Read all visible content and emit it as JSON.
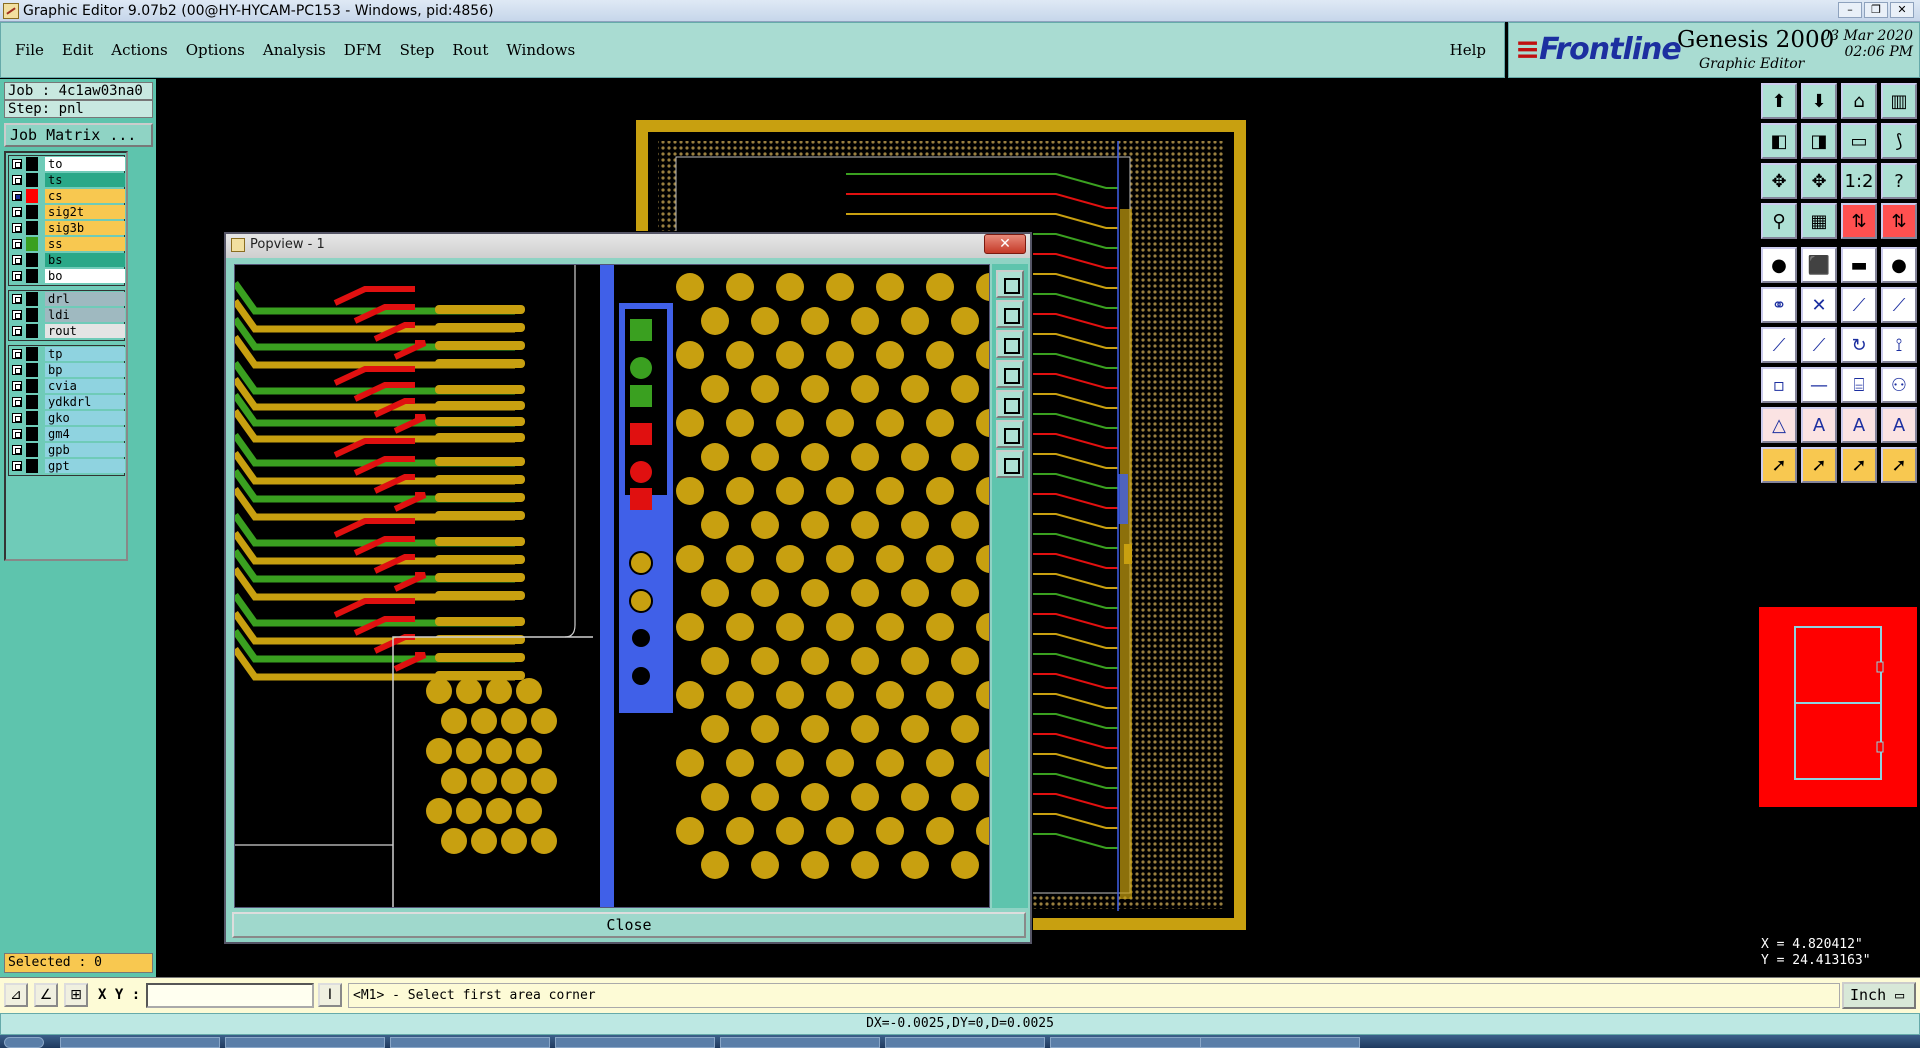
{
  "titlebar": {
    "title": "Graphic Editor 9.07b2 (00@HY-HYCAM-PC153 - Windows, pid:4856)"
  },
  "menu": {
    "items": [
      "File",
      "Edit",
      "Actions",
      "Options",
      "Analysis",
      "DFM",
      "Step",
      "Rout",
      "Windows"
    ],
    "help": "Help"
  },
  "brand": {
    "logo": "Frontline",
    "product": "Genesis 2000",
    "subtitle": "Graphic Editor",
    "date": "03 Mar 2020",
    "time": "02:06 PM"
  },
  "job": {
    "job_line": "Job : 4c1aw03na0",
    "step_line": "Step: pnl",
    "matrix_button": "Job Matrix ..."
  },
  "layers": {
    "group1": [
      {
        "name": "to",
        "swatch": "#000000",
        "bg": "#ffffff",
        "checked": false
      },
      {
        "name": "ts",
        "swatch": "#000000",
        "bg": "#2aa888",
        "checked": false
      },
      {
        "name": "cs",
        "swatch": "#ff0000",
        "bg": "#f8c850",
        "checked": true
      },
      {
        "name": "sig2t",
        "swatch": "#000000",
        "bg": "#f8c850",
        "checked": false
      },
      {
        "name": "sig3b",
        "swatch": "#000000",
        "bg": "#f8c850",
        "checked": false
      },
      {
        "name": "ss",
        "swatch": "#3aa020",
        "bg": "#f8c850",
        "checked": false
      },
      {
        "name": "bs",
        "swatch": "#000000",
        "bg": "#2aa888",
        "checked": false
      },
      {
        "name": "bo",
        "swatch": "#000000",
        "bg": "#ffffff",
        "checked": false
      }
    ],
    "group2": [
      {
        "name": "drl",
        "swatch": "#000000",
        "bg": "#9fb9c0",
        "checked": false
      },
      {
        "name": "ldi",
        "swatch": "#000000",
        "bg": "#9fb9c0",
        "checked": false
      },
      {
        "name": "rout",
        "swatch": "#000000",
        "bg": "#e4e4e4",
        "checked": false
      }
    ],
    "group3": [
      {
        "name": "tp",
        "swatch": "#000000",
        "bg": "#8fd3e0",
        "checked": false
      },
      {
        "name": "bp",
        "swatch": "#000000",
        "bg": "#8fd3e0",
        "checked": false
      },
      {
        "name": "cvia",
        "swatch": "#000000",
        "bg": "#8fd3e0",
        "checked": false
      },
      {
        "name": "ydkdrl",
        "swatch": "#000000",
        "bg": "#8fd3e0",
        "checked": false
      },
      {
        "name": "gko",
        "swatch": "#000000",
        "bg": "#8fd3e0",
        "checked": false
      },
      {
        "name": "gm4",
        "swatch": "#000000",
        "bg": "#8fd3e0",
        "checked": false
      },
      {
        "name": "gpb",
        "swatch": "#000000",
        "bg": "#8fd3e0",
        "checked": false
      },
      {
        "name": "gpt",
        "swatch": "#000000",
        "bg": "#8fd3e0",
        "checked": false
      }
    ]
  },
  "selected": "Selected : 0",
  "popview": {
    "title": "Popview - 1",
    "close_label": "Close"
  },
  "coords": {
    "x": "X = 4.820412\"",
    "y": "Y = 24.413163\""
  },
  "bottom": {
    "xy_label": "X Y :",
    "xy_value": "",
    "prompt": "<M1> - Select first area corner",
    "unit": "Inch",
    "status": "DX=-0.0025,DY=0,D=0.0025"
  },
  "colors": {
    "copper": "#c8a010",
    "trace_red": "#e01010",
    "trace_green": "#3aa020",
    "pad_blue": "#4060e8",
    "background": "#000000",
    "panel_teal": "#5ec4ad"
  }
}
